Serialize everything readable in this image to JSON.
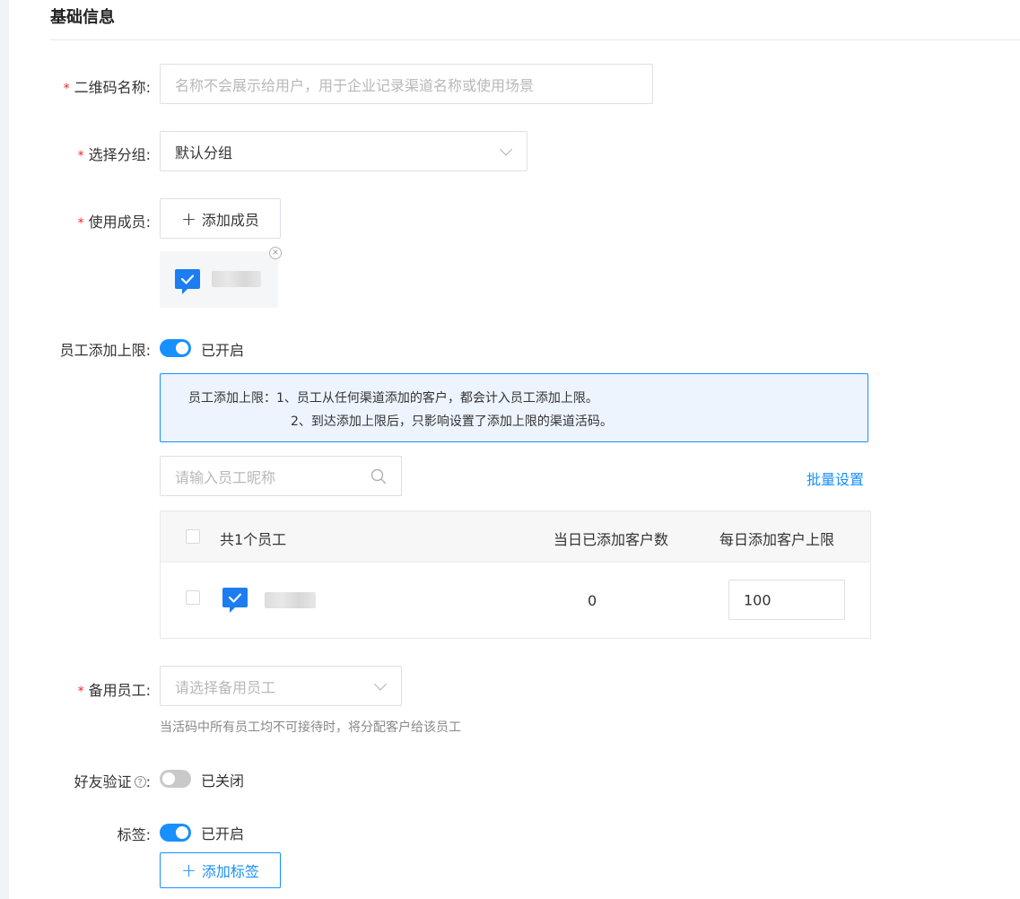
{
  "section": {
    "title": "基础信息"
  },
  "qrcode_name": {
    "label": "二维码名称:",
    "placeholder": "名称不会展示给用户，用于企业记录渠道名称或使用场景",
    "required_mark": "*"
  },
  "group": {
    "label": "选择分组:",
    "value": "默认分组",
    "required_mark": "*"
  },
  "members": {
    "label": "使用成员:",
    "add_button": "添加成员",
    "add_icon": "+",
    "close_icon": "×",
    "required_mark": "*"
  },
  "employee_limit": {
    "label": "员工添加上限:",
    "toggle_state": "on",
    "toggle_text": "已开启",
    "info_line1": "员工添加上限：1、员工从任何渠道添加的客户，都会计入员工添加上限。",
    "info_line2": "2、到达添加上限后，只影响设置了添加上限的渠道活码。",
    "search_placeholder": "请输入员工昵称",
    "batch_link": "批量设置"
  },
  "staff_table": {
    "columns": [
      "共1个员工",
      "当日已添加客户数",
      "每日添加客户上限"
    ],
    "rows": [
      {
        "added_today": "0",
        "daily_limit": "100"
      }
    ]
  },
  "backup_staff": {
    "label": "备用员工:",
    "placeholder": "请选择备用员工",
    "hint": "当活码中所有员工均不可接待时，将分配客户给该员工",
    "required_mark": "*"
  },
  "friend_verify": {
    "label": "好友验证",
    "help_icon": "?",
    "colon": ":",
    "toggle_state": "off",
    "toggle_text": "已关闭"
  },
  "tags": {
    "label": "标签:",
    "toggle_state": "on",
    "toggle_text": "已开启",
    "add_button": "添加标签",
    "add_icon": "+"
  },
  "colors": {
    "accent": "#1890ff",
    "required": "#f5222d",
    "info_bg": "#edf4fd"
  }
}
